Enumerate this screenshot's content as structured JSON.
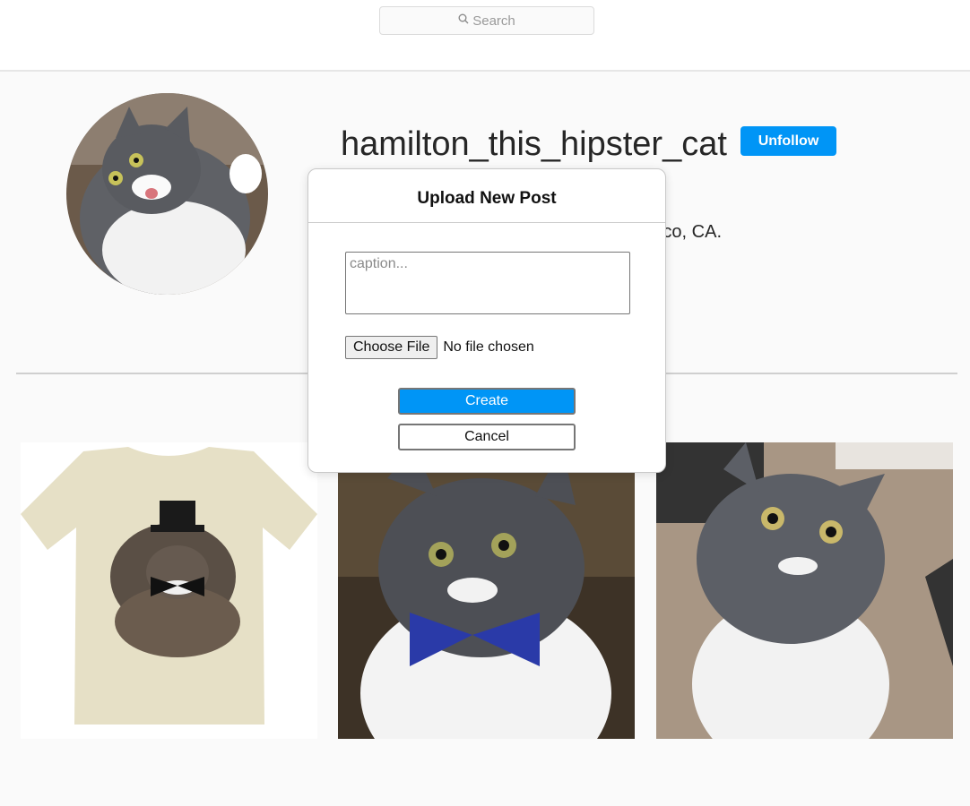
{
  "header": {
    "search_placeholder": "Search",
    "search_icon": "search-icon"
  },
  "profile": {
    "username": "hamilton_this_hipster_cat",
    "follow_button": "Unfollow",
    "location_visible": "co, CA."
  },
  "modal": {
    "title": "Upload New Post",
    "caption_placeholder": "caption...",
    "choose_file_label": "Choose File",
    "file_status": "No file chosen",
    "create_label": "Create",
    "cancel_label": "Cancel"
  },
  "colors": {
    "accent": "#0095f6",
    "background": "#fafafa"
  }
}
